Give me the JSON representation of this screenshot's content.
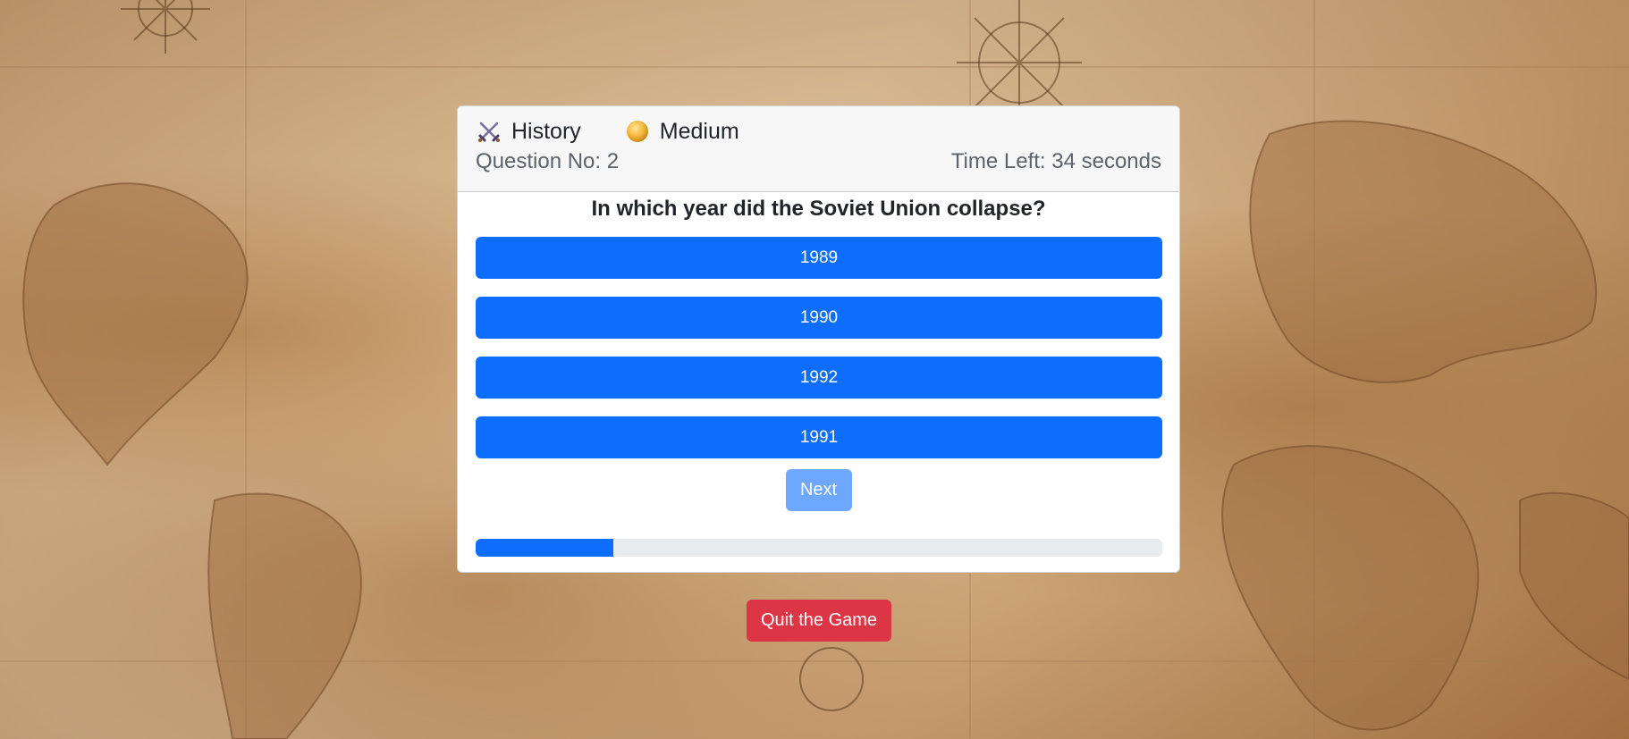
{
  "header": {
    "category_icon": "crossed-swords-icon",
    "category": "History",
    "difficulty_icon": "medal-coin-icon",
    "difficulty": "Medium",
    "question_number": "Question No: 2",
    "time_left": "Time Left: 34 seconds"
  },
  "question": {
    "text": "In which year did the Soviet Union collapse?",
    "options": [
      "1989",
      "1990",
      "1992",
      "1991"
    ]
  },
  "controls": {
    "next_label": "Next",
    "quit_label": "Quit the Game"
  },
  "progress": {
    "fraction": 0.2
  },
  "colors": {
    "primary": "#0d6efd",
    "primary_disabled": "#6ea8fe",
    "danger": "#dc3545",
    "progress_track": "#e9ecef"
  }
}
